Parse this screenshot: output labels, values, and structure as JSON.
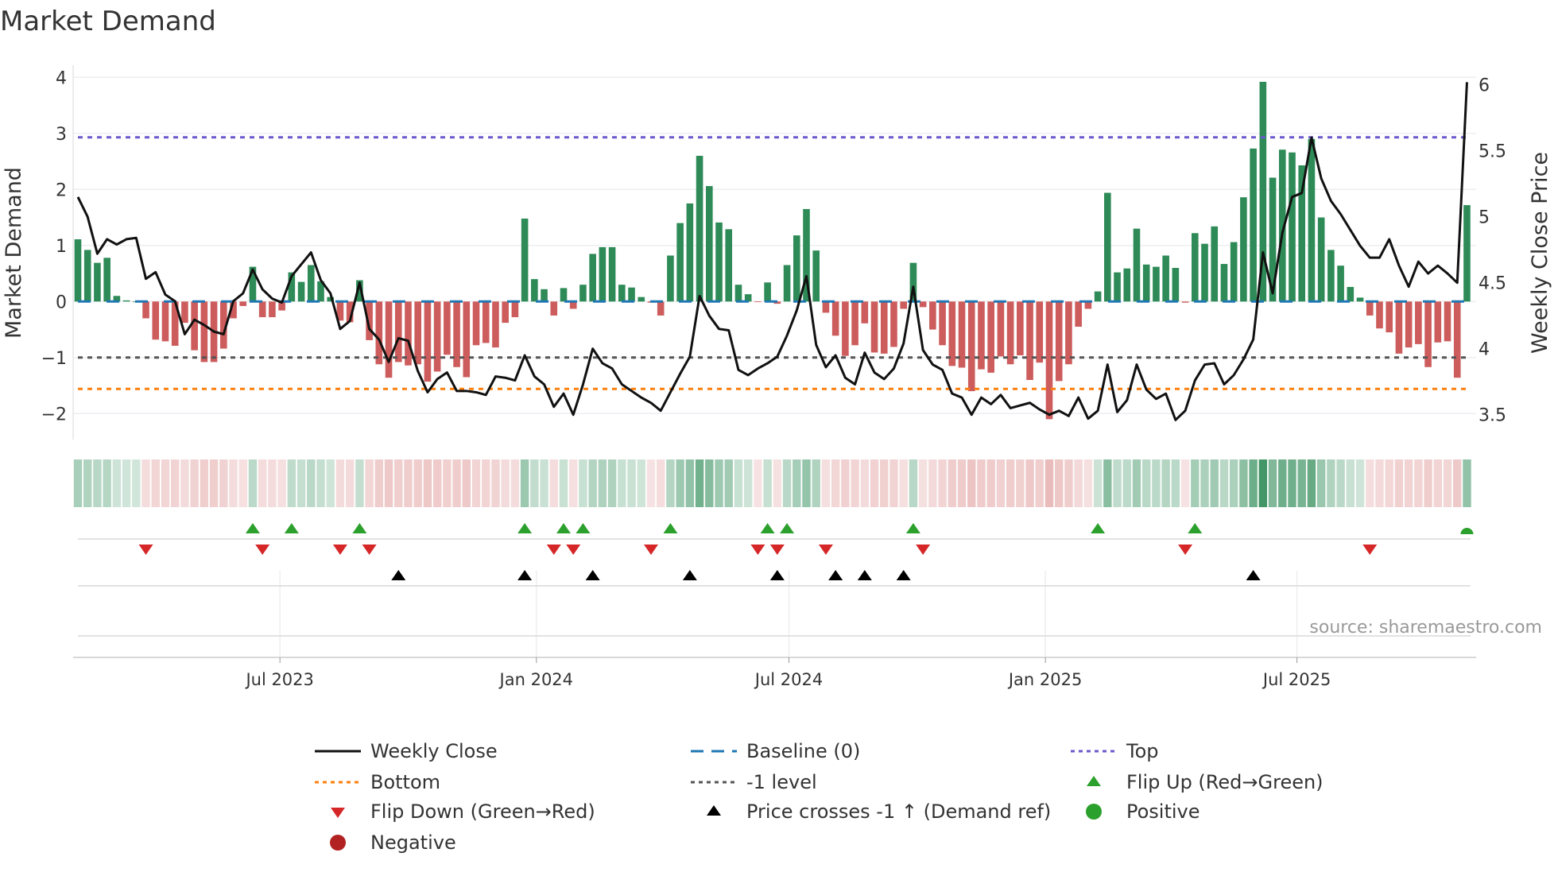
{
  "chart_data": {
    "type": "bar",
    "title": "Market Demand",
    "ylabel": "Market Demand",
    "y2label": "Weekly Close Price",
    "ylim": [
      -2.45,
      4.1
    ],
    "y2lim": [
      3.3,
      6.1
    ],
    "yticks": [
      "4",
      "3",
      "2",
      "1",
      "0",
      "−1",
      "−2"
    ],
    "ytick_values": [
      4,
      3,
      2,
      1,
      0,
      -1,
      -2
    ],
    "y2ticks": [
      "6",
      "5.5",
      "5",
      "4.5",
      "4",
      "3.5"
    ],
    "y2tick_values": [
      6,
      5.5,
      5,
      4.5,
      4,
      3.5
    ],
    "x_frequency": "weekly",
    "x_start": "2023-02-03",
    "xticks": [
      {
        "label": "Jul 2023",
        "week": 20.8
      },
      {
        "label": "Jan 2024",
        "week": 47.2
      },
      {
        "label": "Jul 2024",
        "week": 73.2
      },
      {
        "label": "Jan 2025",
        "week": 99.6
      },
      {
        "label": "Jul 2025",
        "week": 125.5
      }
    ],
    "series": [
      {
        "name": "Market Demand",
        "kind": "bar",
        "values": [
          1.11,
          0.92,
          0.69,
          0.78,
          0.1,
          0.02,
          0,
          -0.3,
          -0.68,
          -0.71,
          -0.79,
          -0.38,
          -0.87,
          -1.08,
          -1.08,
          -0.84,
          -0.3,
          -0.08,
          0.62,
          -0.28,
          -0.28,
          -0.16,
          0.52,
          0.35,
          0.65,
          0.36,
          0.08,
          -0.34,
          -0.37,
          0.38,
          -0.69,
          -1.12,
          -1.36,
          -1.08,
          -1.14,
          -1.12,
          -1.43,
          -1.25,
          -0.95,
          -1.17,
          -1.35,
          -0.78,
          -0.74,
          -0.82,
          -0.38,
          -0.28,
          1.48,
          0.4,
          0.22,
          -0.25,
          0.24,
          -0.13,
          0.3,
          0.85,
          0.97,
          0.97,
          0.3,
          0.25,
          0.08,
          -0.02,
          -0.25,
          0.82,
          1.4,
          1.75,
          2.6,
          2.06,
          1.41,
          1.29,
          0.3,
          0.13,
          -0.01,
          0.34,
          -0.04,
          0.65,
          1.18,
          1.65,
          0.91,
          -0.2,
          -0.61,
          -0.97,
          -0.78,
          -0.39,
          -0.91,
          -0.93,
          -0.81,
          -0.13,
          0.69,
          -0.1,
          -0.5,
          -0.78,
          -1.15,
          -1.18,
          -1.6,
          -1.21,
          -1.27,
          -0.98,
          -1.12,
          -0.96,
          -1.4,
          -1.09,
          -2.1,
          -1.42,
          -1.12,
          -0.45,
          -0.13,
          0.18,
          1.94,
          0.52,
          0.59,
          1.3,
          0.66,
          0.62,
          0.82,
          0.6,
          -0.02,
          1.22,
          1.03,
          1.34,
          0.67,
          1.06,
          1.86,
          2.73,
          3.92,
          2.21,
          2.71,
          2.66,
          2.43,
          2.9,
          1.5,
          0.92,
          0.64,
          0.26,
          0.07,
          -0.25,
          -0.48,
          -0.55,
          -0.93,
          -0.82,
          -0.76,
          -1.17,
          -0.73,
          -0.71,
          -1.36,
          1.72
        ]
      },
      {
        "name": "Weekly Close",
        "kind": "line",
        "axis": "right",
        "values": [
          5.15,
          5.0,
          4.72,
          4.83,
          4.79,
          4.83,
          4.84,
          4.53,
          4.58,
          4.41,
          4.36,
          4.11,
          4.22,
          4.18,
          4.13,
          4.11,
          4.36,
          4.42,
          4.6,
          4.45,
          4.38,
          4.35,
          4.55,
          4.64,
          4.73,
          4.52,
          4.42,
          4.15,
          4.21,
          4.5,
          4.15,
          4.07,
          3.9,
          4.08,
          4.06,
          3.83,
          3.67,
          3.77,
          3.82,
          3.68,
          3.68,
          3.67,
          3.65,
          3.79,
          3.78,
          3.76,
          3.95,
          3.79,
          3.73,
          3.56,
          3.66,
          3.5,
          3.73,
          4.0,
          3.89,
          3.85,
          3.73,
          3.68,
          3.63,
          3.59,
          3.53,
          3.67,
          3.81,
          3.94,
          4.4,
          4.25,
          4.15,
          4.14,
          3.84,
          3.8,
          3.85,
          3.89,
          3.94,
          4.1,
          4.29,
          4.55,
          4.03,
          3.86,
          3.95,
          3.78,
          3.73,
          3.97,
          3.82,
          3.77,
          3.85,
          4.04,
          4.47,
          3.99,
          3.88,
          3.84,
          3.66,
          3.63,
          3.5,
          3.63,
          3.58,
          3.65,
          3.55,
          3.57,
          3.59,
          3.54,
          3.5,
          3.53,
          3.49,
          3.63,
          3.47,
          3.53,
          3.88,
          3.52,
          3.61,
          3.88,
          3.69,
          3.62,
          3.66,
          3.46,
          3.53,
          3.76,
          3.88,
          3.89,
          3.73,
          3.8,
          3.92,
          4.07,
          4.73,
          4.42,
          4.88,
          5.15,
          5.18,
          5.6,
          5.29,
          5.12,
          5.02,
          4.9,
          4.78,
          4.69,
          4.69,
          4.83,
          4.63,
          4.47,
          4.66,
          4.57,
          4.63,
          4.57,
          4.5,
          6.02
        ]
      }
    ],
    "reference_lines": {
      "top": 2.93,
      "baseline": 0,
      "minus_one": -1,
      "bottom": -1.56
    },
    "events": {
      "flip_up_weeks": [
        18,
        22,
        29,
        46,
        50,
        52,
        61,
        71,
        73,
        86,
        105,
        115
      ],
      "flip_down_weeks": [
        7,
        19,
        27,
        30,
        49,
        51,
        59,
        70,
        72,
        77,
        87,
        114,
        133
      ],
      "price_cross_weeks": [
        33,
        46,
        53,
        63,
        72,
        78,
        81,
        85,
        121
      ],
      "positive_weeks": [
        143
      ]
    },
    "colors": {
      "positive_bar": "#2e8b57",
      "negative_bar": "#cd5c5c",
      "price": "#111111",
      "baseline": "#1f77b4",
      "top": "#6a5acd",
      "bottom": "#ff7f0e",
      "minus_one": "#555555",
      "flip_up": "#2ca02c",
      "flip_down": "#d62728",
      "negative": "#b22222",
      "positive": "#2ca02c",
      "cross": "#000000"
    },
    "legend": {
      "placement": "bottom",
      "items": [
        {
          "label": "Weekly Close",
          "symbol": "line",
          "color": "#111111"
        },
        {
          "label": "Baseline (0)",
          "symbol": "dash",
          "color": "#1f77b4"
        },
        {
          "label": "Top",
          "symbol": "dot",
          "color": "#6a5acd"
        },
        {
          "label": "Bottom",
          "symbol": "dot",
          "color": "#ff7f0e"
        },
        {
          "label": "-1 level",
          "symbol": "dot",
          "color": "#555555"
        },
        {
          "label": "Flip Up (Red→Green)",
          "symbol": "tri-up",
          "color": "#2ca02c"
        },
        {
          "label": "Flip Down (Green→Red)",
          "symbol": "tri-down",
          "color": "#d62728"
        },
        {
          "label": "Price crosses -1 ↑ (Demand ref)",
          "symbol": "tri-up",
          "color": "#000000"
        },
        {
          "label": "Positive",
          "symbol": "circle",
          "color": "#2ca02c"
        },
        {
          "label": "Negative",
          "symbol": "circle",
          "color": "#b22222"
        }
      ]
    },
    "source": "source: sharemaestro.com"
  }
}
